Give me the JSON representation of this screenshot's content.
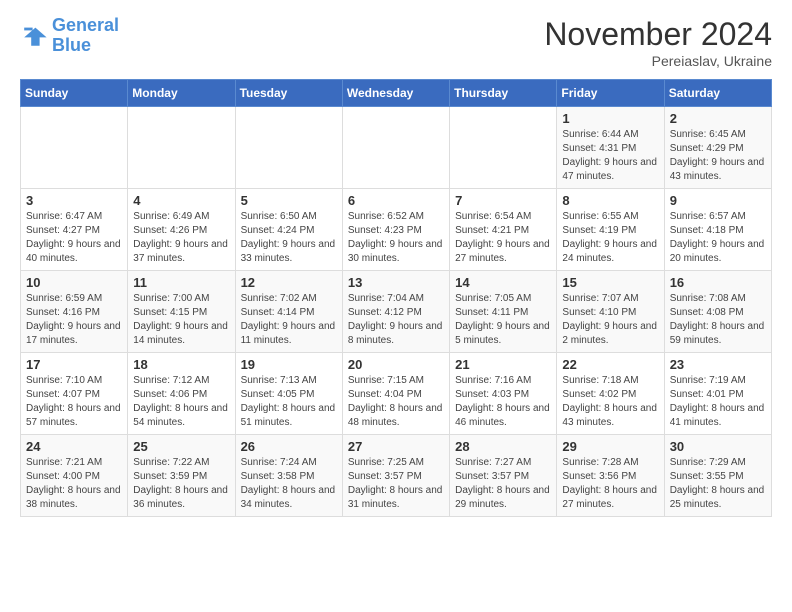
{
  "logo": {
    "line1": "General",
    "line2": "Blue"
  },
  "title": "November 2024",
  "location": "Pereiaslav, Ukraine",
  "weekdays": [
    "Sunday",
    "Monday",
    "Tuesday",
    "Wednesday",
    "Thursday",
    "Friday",
    "Saturday"
  ],
  "weeks": [
    [
      null,
      null,
      null,
      null,
      null,
      {
        "day": "1",
        "sunrise": "6:44 AM",
        "sunset": "4:31 PM",
        "daylight": "9 hours and 47 minutes."
      },
      {
        "day": "2",
        "sunrise": "6:45 AM",
        "sunset": "4:29 PM",
        "daylight": "9 hours and 43 minutes."
      }
    ],
    [
      {
        "day": "3",
        "sunrise": "6:47 AM",
        "sunset": "4:27 PM",
        "daylight": "9 hours and 40 minutes."
      },
      {
        "day": "4",
        "sunrise": "6:49 AM",
        "sunset": "4:26 PM",
        "daylight": "9 hours and 37 minutes."
      },
      {
        "day": "5",
        "sunrise": "6:50 AM",
        "sunset": "4:24 PM",
        "daylight": "9 hours and 33 minutes."
      },
      {
        "day": "6",
        "sunrise": "6:52 AM",
        "sunset": "4:23 PM",
        "daylight": "9 hours and 30 minutes."
      },
      {
        "day": "7",
        "sunrise": "6:54 AM",
        "sunset": "4:21 PM",
        "daylight": "9 hours and 27 minutes."
      },
      {
        "day": "8",
        "sunrise": "6:55 AM",
        "sunset": "4:19 PM",
        "daylight": "9 hours and 24 minutes."
      },
      {
        "day": "9",
        "sunrise": "6:57 AM",
        "sunset": "4:18 PM",
        "daylight": "9 hours and 20 minutes."
      }
    ],
    [
      {
        "day": "10",
        "sunrise": "6:59 AM",
        "sunset": "4:16 PM",
        "daylight": "9 hours and 17 minutes."
      },
      {
        "day": "11",
        "sunrise": "7:00 AM",
        "sunset": "4:15 PM",
        "daylight": "9 hours and 14 minutes."
      },
      {
        "day": "12",
        "sunrise": "7:02 AM",
        "sunset": "4:14 PM",
        "daylight": "9 hours and 11 minutes."
      },
      {
        "day": "13",
        "sunrise": "7:04 AM",
        "sunset": "4:12 PM",
        "daylight": "9 hours and 8 minutes."
      },
      {
        "day": "14",
        "sunrise": "7:05 AM",
        "sunset": "4:11 PM",
        "daylight": "9 hours and 5 minutes."
      },
      {
        "day": "15",
        "sunrise": "7:07 AM",
        "sunset": "4:10 PM",
        "daylight": "9 hours and 2 minutes."
      },
      {
        "day": "16",
        "sunrise": "7:08 AM",
        "sunset": "4:08 PM",
        "daylight": "8 hours and 59 minutes."
      }
    ],
    [
      {
        "day": "17",
        "sunrise": "7:10 AM",
        "sunset": "4:07 PM",
        "daylight": "8 hours and 57 minutes."
      },
      {
        "day": "18",
        "sunrise": "7:12 AM",
        "sunset": "4:06 PM",
        "daylight": "8 hours and 54 minutes."
      },
      {
        "day": "19",
        "sunrise": "7:13 AM",
        "sunset": "4:05 PM",
        "daylight": "8 hours and 51 minutes."
      },
      {
        "day": "20",
        "sunrise": "7:15 AM",
        "sunset": "4:04 PM",
        "daylight": "8 hours and 48 minutes."
      },
      {
        "day": "21",
        "sunrise": "7:16 AM",
        "sunset": "4:03 PM",
        "daylight": "8 hours and 46 minutes."
      },
      {
        "day": "22",
        "sunrise": "7:18 AM",
        "sunset": "4:02 PM",
        "daylight": "8 hours and 43 minutes."
      },
      {
        "day": "23",
        "sunrise": "7:19 AM",
        "sunset": "4:01 PM",
        "daylight": "8 hours and 41 minutes."
      }
    ],
    [
      {
        "day": "24",
        "sunrise": "7:21 AM",
        "sunset": "4:00 PM",
        "daylight": "8 hours and 38 minutes."
      },
      {
        "day": "25",
        "sunrise": "7:22 AM",
        "sunset": "3:59 PM",
        "daylight": "8 hours and 36 minutes."
      },
      {
        "day": "26",
        "sunrise": "7:24 AM",
        "sunset": "3:58 PM",
        "daylight": "8 hours and 34 minutes."
      },
      {
        "day": "27",
        "sunrise": "7:25 AM",
        "sunset": "3:57 PM",
        "daylight": "8 hours and 31 minutes."
      },
      {
        "day": "28",
        "sunrise": "7:27 AM",
        "sunset": "3:57 PM",
        "daylight": "8 hours and 29 minutes."
      },
      {
        "day": "29",
        "sunrise": "7:28 AM",
        "sunset": "3:56 PM",
        "daylight": "8 hours and 27 minutes."
      },
      {
        "day": "30",
        "sunrise": "7:29 AM",
        "sunset": "3:55 PM",
        "daylight": "8 hours and 25 minutes."
      }
    ]
  ]
}
